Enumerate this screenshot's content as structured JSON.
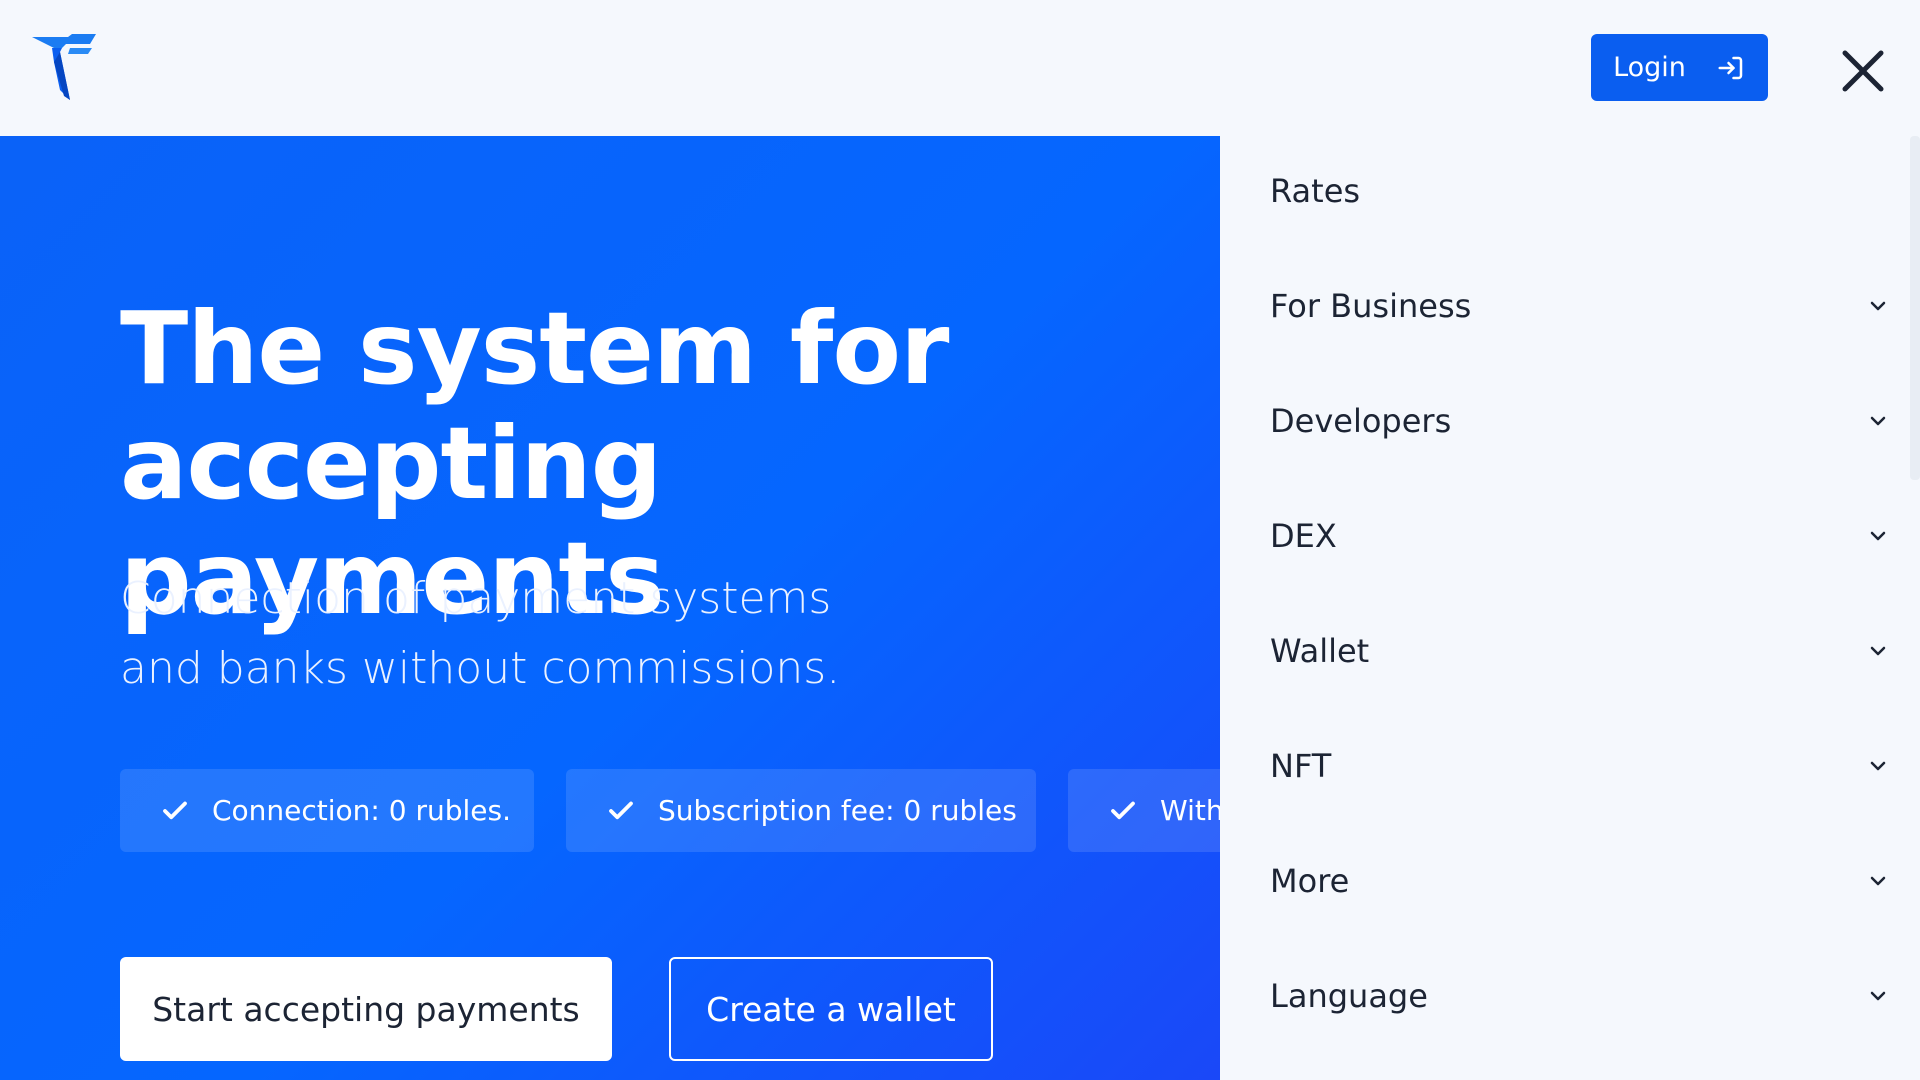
{
  "header": {
    "logo": "t-logo-icon",
    "login_label": "Login",
    "login_icon": "sign-in-icon",
    "close_icon": "close-icon"
  },
  "hero": {
    "title": "The system for accepting\npayments",
    "subtitle": "Connection of payment systems\nand banks without commissions.",
    "features": [
      {
        "label": "Connection: 0 rubles."
      },
      {
        "label": "Subscription fee: 0 rubles"
      },
      {
        "label": "With"
      }
    ],
    "primary_button": "Start accepting payments",
    "secondary_button": "Create a wallet"
  },
  "menu": {
    "items": [
      {
        "label": "Rates",
        "has_chevron": false
      },
      {
        "label": "For Business",
        "has_chevron": true
      },
      {
        "label": "Developers",
        "has_chevron": true
      },
      {
        "label": "DEX",
        "has_chevron": true
      },
      {
        "label": "Wallet",
        "has_chevron": true
      },
      {
        "label": "NFT",
        "has_chevron": true
      },
      {
        "label": "More",
        "has_chevron": true
      },
      {
        "label": "Language",
        "has_chevron": true
      }
    ]
  },
  "colors": {
    "brand_blue": "#0a5ef0",
    "hero_blue": "#0566ff",
    "text_dark": "#1c2434",
    "panel_bg": "#f5f8fd"
  }
}
